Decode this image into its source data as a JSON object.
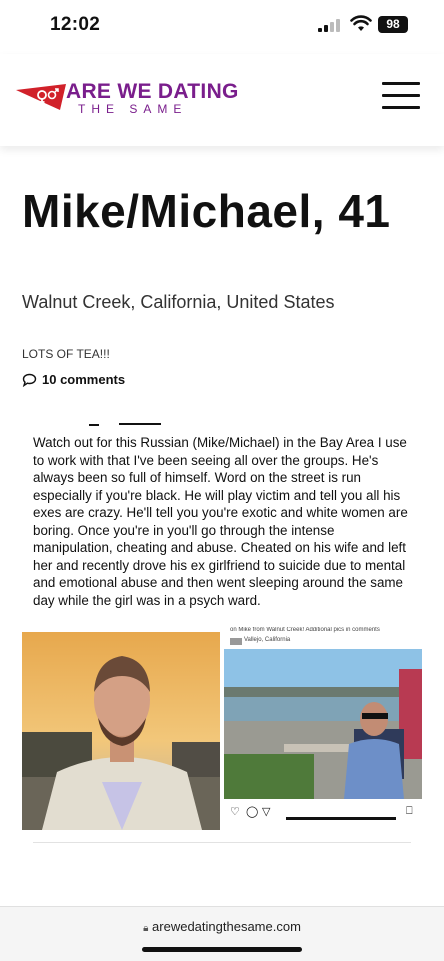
{
  "status": {
    "time": "12:02",
    "battery": "98"
  },
  "header": {
    "logo_line1": "ARE WE DATING",
    "logo_line2": "THE SAME"
  },
  "post": {
    "title": "Mike/Michael, 41",
    "location": "Walnut Creek, California, United States",
    "tagline": "LOTS OF TEA!!!",
    "comments": "10 comments",
    "body": "Watch out for this Russian (Mike/Michael) in the Bay Area I use to work with that I've been seeing all over the groups. He's always been so full of himself. Word on the street is run especially if you're black. He will play victim and tell you all his exes are crazy. He'll tell you you're exotic and white women are boring. Once you're in you'll go through the intense manipulation, cheating and abuse. Cheated on his wife and left her and recently drove his ex girlfriend to suicide due to mental and emotional abuse and then went sleeping around the same day while the girl was in a psych ward."
  },
  "photo_right": {
    "caption": "on Mike from Walnut Creek! Additional pics in comments",
    "location": "Vallejo, California"
  },
  "browser": {
    "url": "arewedatingthesame.com"
  }
}
